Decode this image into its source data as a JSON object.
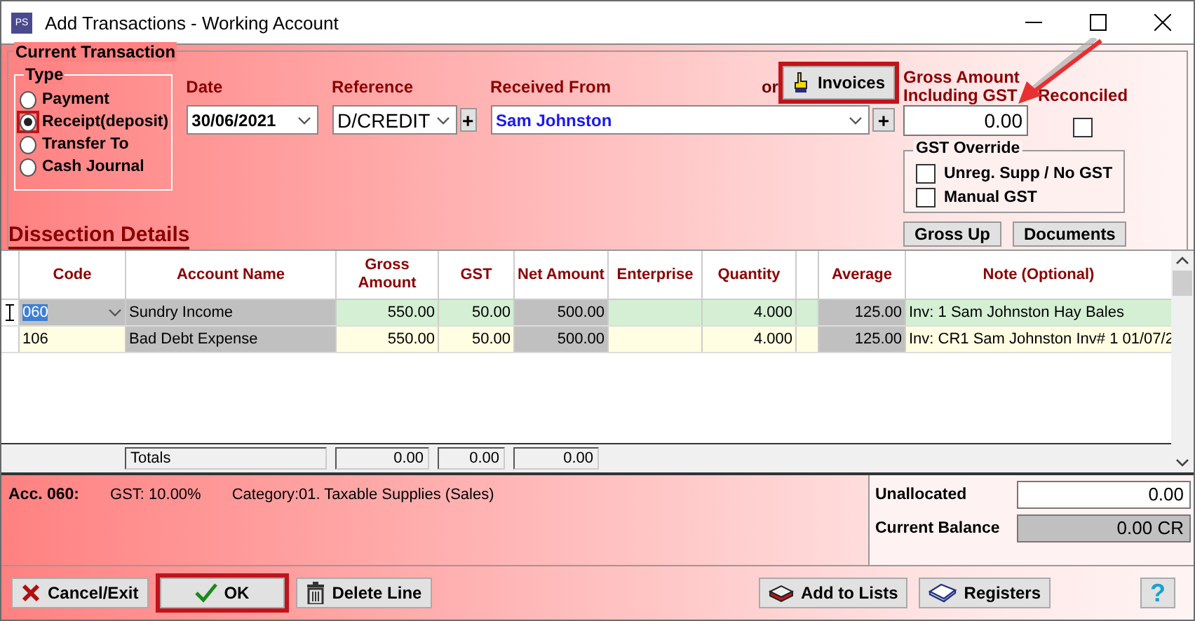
{
  "window": {
    "title": "Add Transactions - Working Account",
    "app_icon": "PS"
  },
  "current_transaction": {
    "legend": "Current Transaction",
    "type": {
      "legend": "Type",
      "options": [
        {
          "label": "Payment",
          "selected": false,
          "highlighted": false
        },
        {
          "label": "Receipt(deposit)",
          "selected": true,
          "highlighted": true
        },
        {
          "label": "Transfer To",
          "selected": false,
          "highlighted": false
        },
        {
          "label": "Cash Journal",
          "selected": false,
          "highlighted": false
        }
      ]
    },
    "date": {
      "label": "Date",
      "value": "30/06/2021"
    },
    "reference": {
      "label": "Reference",
      "value": "D/CREDIT",
      "add_button": "+"
    },
    "received_from": {
      "label": "Received From",
      "value": "Sam Johnston",
      "add_button": "+"
    },
    "or_text": "or",
    "invoices_button": {
      "label": "Invoices",
      "highlighted": true
    },
    "gross_amount": {
      "label": "Gross Amount Including GST",
      "value": "0.00"
    },
    "reconciled": {
      "label": "Reconciled",
      "checked": false
    },
    "gst_override": {
      "legend": "GST Override",
      "options": [
        {
          "label": "Unreg. Supp / No GST",
          "checked": false
        },
        {
          "label": "Manual GST",
          "checked": false
        }
      ]
    },
    "buttons": [
      "Gross Up",
      "Documents"
    ]
  },
  "dissection": {
    "title": "Dissection Details",
    "columns": [
      {
        "label": "Code",
        "kind": "input"
      },
      {
        "label": "Account Name",
        "kind": "calc"
      },
      {
        "label": "Gross Amount",
        "kind": "input"
      },
      {
        "label": "GST",
        "kind": "input"
      },
      {
        "label": "Net Amount",
        "kind": "calc"
      },
      {
        "label": "Enterprise",
        "kind": "input"
      },
      {
        "label": "Quantity",
        "kind": "input"
      },
      {
        "label": "Average",
        "kind": "calc"
      },
      {
        "label": "Note (Optional)",
        "kind": "input"
      }
    ],
    "rows": [
      {
        "selected": true,
        "cells": [
          "060",
          "Sundry Income",
          "550.00",
          "50.00",
          "500.00",
          null,
          "4.000",
          "125.00",
          "Inv: 1 Sam Johnston Hay Bales"
        ]
      },
      {
        "selected": false,
        "cells": [
          "106",
          "Bad Debt Expense",
          "550.00",
          "50.00",
          "500.00",
          null,
          "4.000",
          "125.00",
          "Inv: CR1 Sam Johnston Inv# 1 01/07/2"
        ]
      }
    ],
    "totals": {
      "label": "Totals",
      "values": [
        "0.00",
        "0.00",
        "0.00"
      ]
    }
  },
  "account_info": {
    "account": "Acc. 060:",
    "gst": "GST: 10.00%",
    "category": "Category:01. Taxable Supplies (Sales)"
  },
  "balances": {
    "unallocated": {
      "label": "Unallocated",
      "value": "0.00"
    },
    "current_balance": {
      "label": "Current Balance",
      "value": "0.00 CR"
    }
  },
  "footer_buttons": [
    {
      "label": "Cancel/Exit",
      "kind": "cancel",
      "highlighted": false
    },
    {
      "label": "OK",
      "kind": "ok",
      "highlighted": true
    },
    {
      "label": "Delete Line",
      "kind": "delete",
      "highlighted": false
    },
    {
      "label": "Add to Lists",
      "kind": "add",
      "highlighted": false
    },
    {
      "label": "Registers",
      "kind": "registers",
      "highlighted": false
    },
    {
      "label": "?",
      "kind": "help",
      "highlighted": false
    }
  ]
}
